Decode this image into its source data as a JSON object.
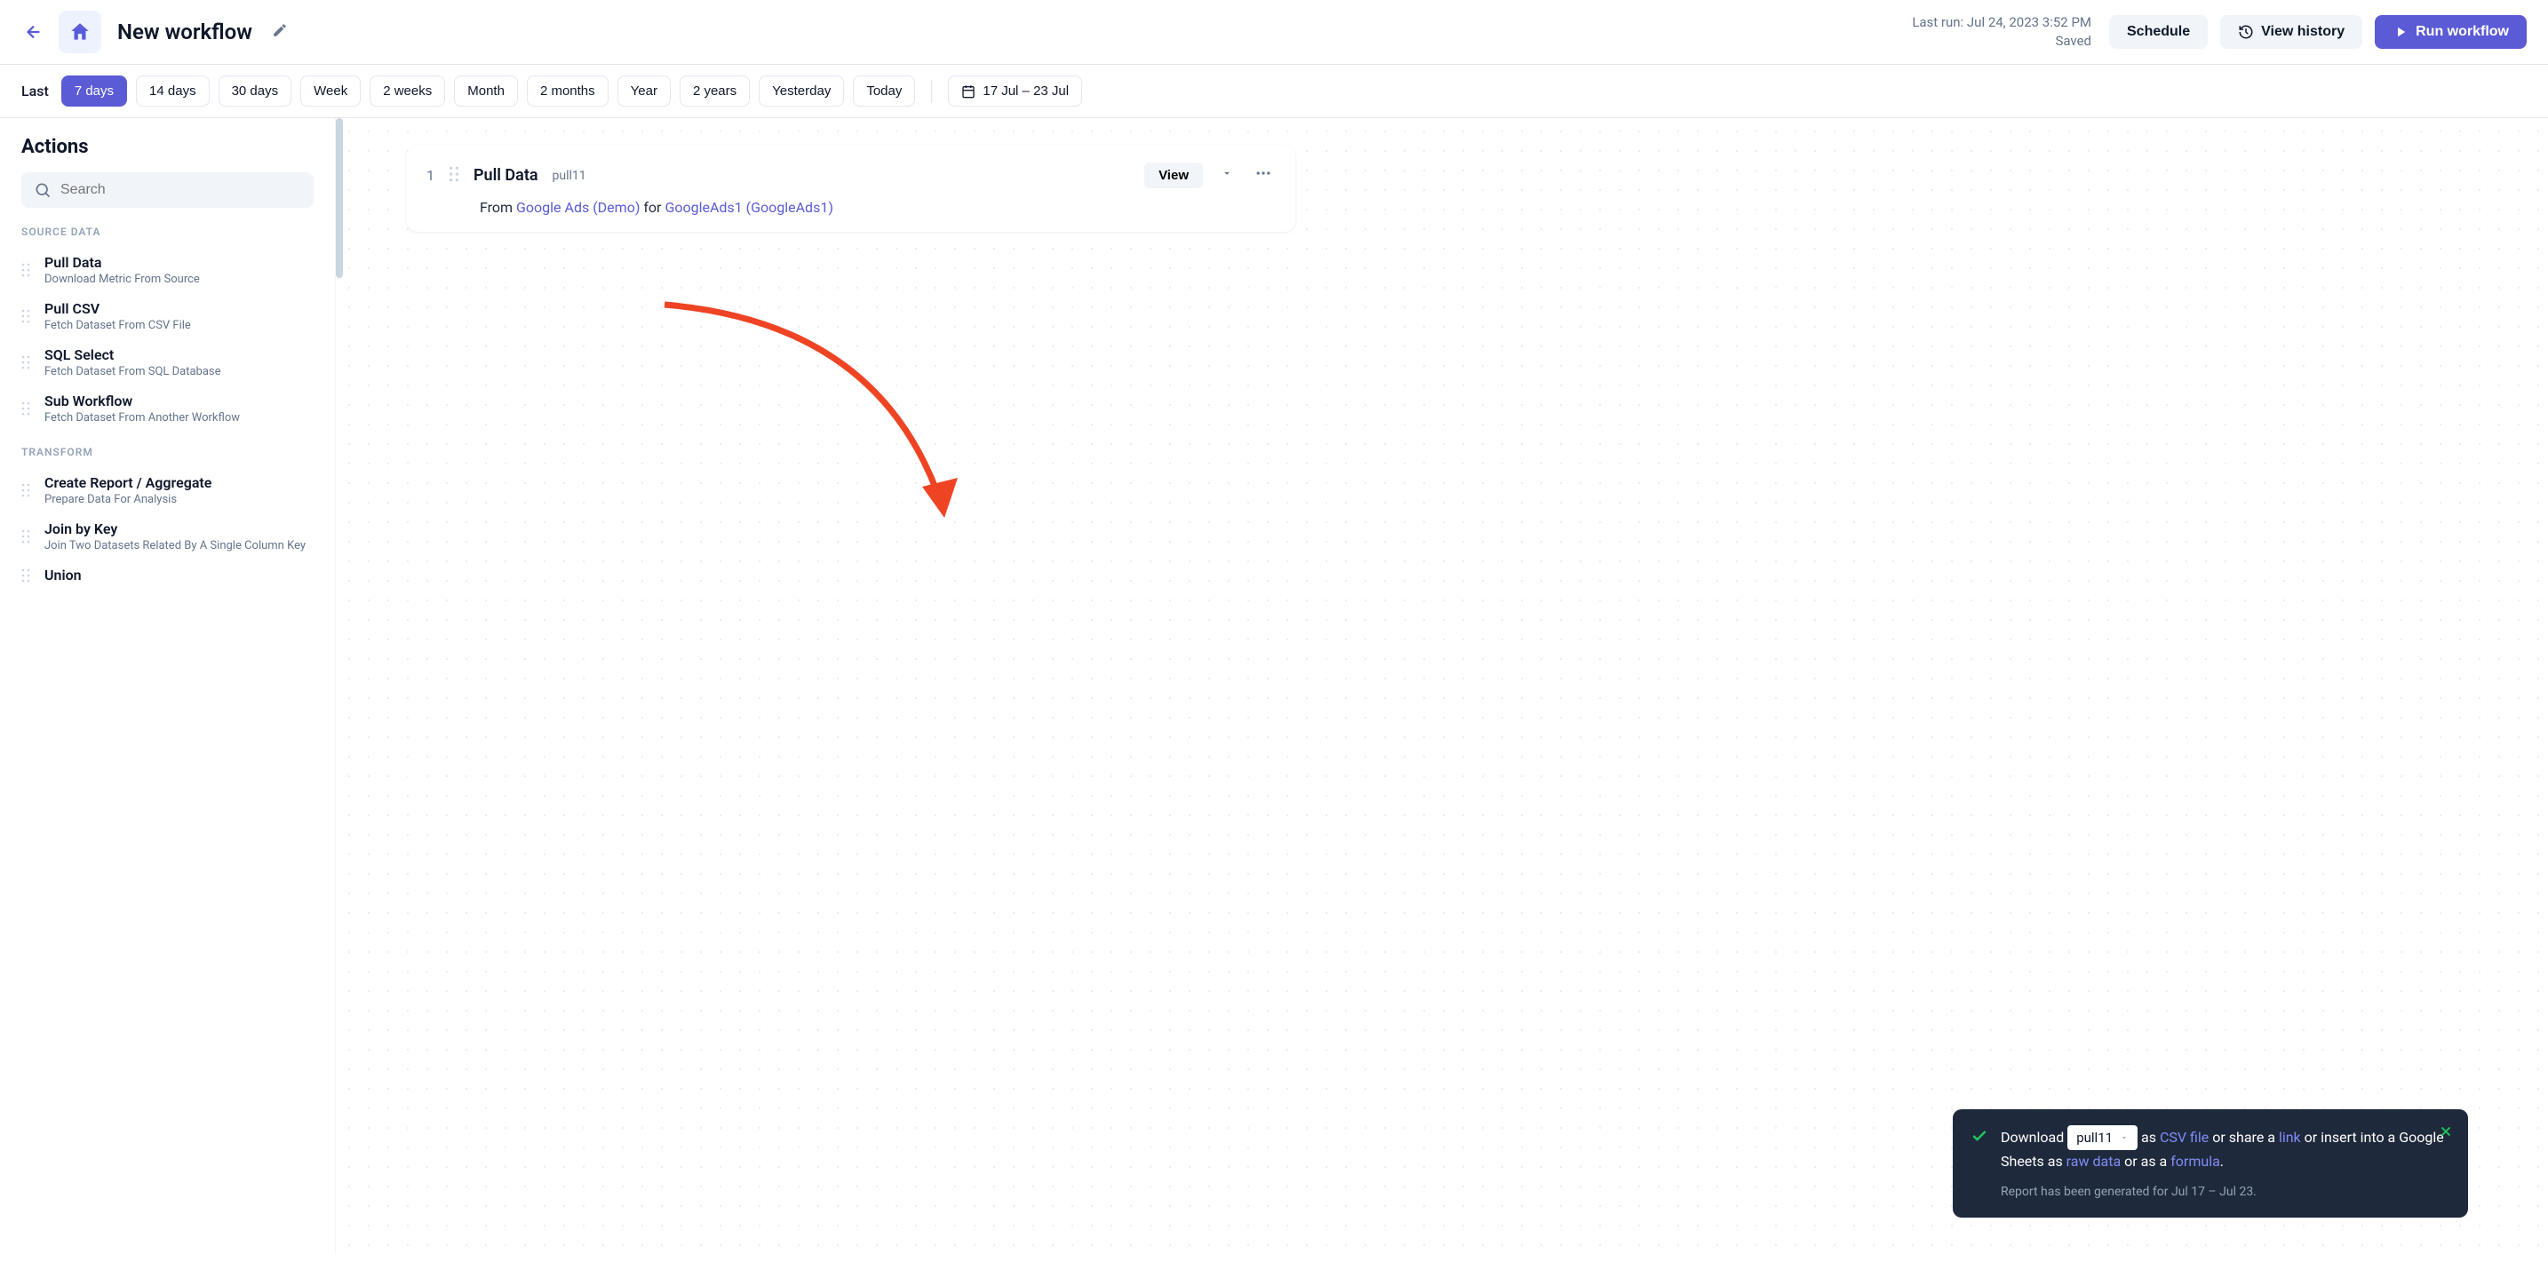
{
  "header": {
    "title": "New workflow",
    "last_run": "Last run: Jul 24, 2023 3:52 PM",
    "saved": "Saved",
    "schedule_btn": "Schedule",
    "history_btn": "View history",
    "run_btn": "Run workflow"
  },
  "datebar": {
    "label": "Last",
    "ranges": [
      "7 days",
      "14 days",
      "30 days",
      "Week",
      "2 weeks",
      "Month",
      "2 months",
      "Year",
      "2 years",
      "Yesterday",
      "Today"
    ],
    "active_index": 0,
    "picker": "17 Jul – 23 Jul"
  },
  "sidebar": {
    "heading": "Actions",
    "search_placeholder": "Search",
    "sections": [
      {
        "label": "SOURCE DATA",
        "items": [
          {
            "title": "Pull Data",
            "desc": "Download Metric From Source"
          },
          {
            "title": "Pull CSV",
            "desc": "Fetch Dataset From CSV File"
          },
          {
            "title": "SQL Select",
            "desc": "Fetch Dataset From SQL Database"
          },
          {
            "title": "Sub Workflow",
            "desc": "Fetch Dataset From Another Workflow"
          }
        ]
      },
      {
        "label": "TRANSFORM",
        "items": [
          {
            "title": "Create Report / Aggregate",
            "desc": "Prepare Data For Analysis"
          },
          {
            "title": "Join by Key",
            "desc": "Join Two Datasets Related By A Single Column Key"
          },
          {
            "title": "Union",
            "desc": ""
          }
        ]
      }
    ]
  },
  "step": {
    "num": "1",
    "title": "Pull Data",
    "id": "pull11",
    "view_btn": "View",
    "body_from": "From ",
    "body_source": "Google Ads (Demo)",
    "body_for": " for ",
    "body_account": "GoogleAds1 (GoogleAds1)"
  },
  "toast": {
    "download_prefix": "Download ",
    "select_value": "pull11",
    "as_text": " as ",
    "csv_link": "CSV file",
    "share_text": " or share a ",
    "link_link": "link",
    "insert_text": " or insert into a Google Sheets as ",
    "raw_link": "raw data",
    "or_as_text": " or as a ",
    "formula_link": "formula",
    "period": ".",
    "footer": "Report has been generated for Jul 17 – Jul 23."
  }
}
